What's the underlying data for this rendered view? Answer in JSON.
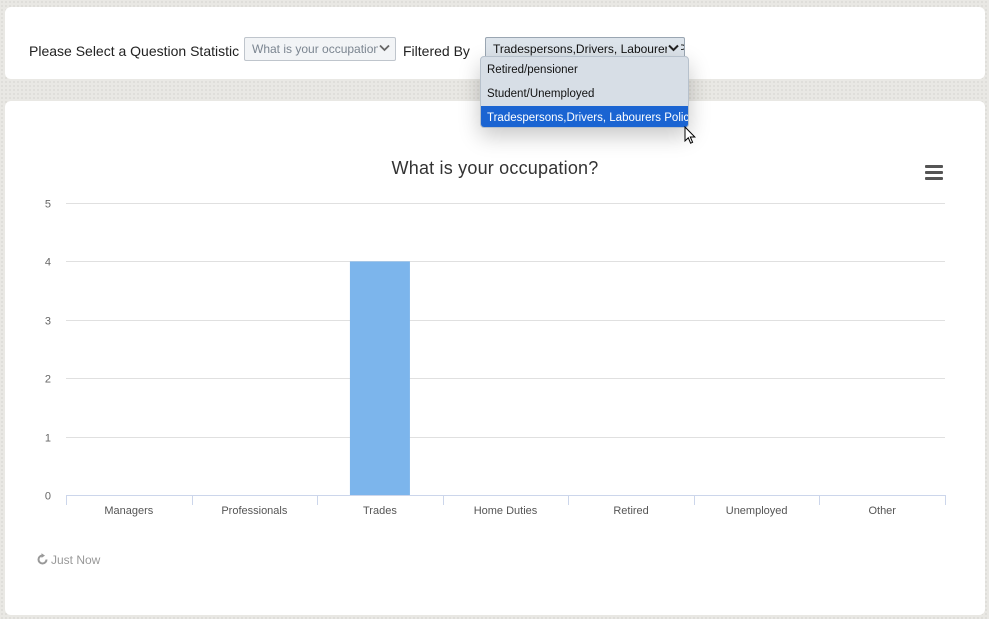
{
  "filter_bar": {
    "question_label": "Please Select a Question Statistic",
    "question_value": "What is your occupation?",
    "filter_label": "Filtered By",
    "filter_value": "Tradespersons,Drivers, Labourers Police",
    "options": [
      "Retired/pensioner",
      "Student/Unemployed",
      "Tradespersons,Drivers, Labourers Police"
    ],
    "selected_option": "Tradespersons,Drivers, Labourers Police"
  },
  "footer": {
    "updated_text": "Just Now"
  },
  "colors": {
    "bar": "#7cb5ec",
    "selected_option_bg": "#1a64d2",
    "grid": "#e0e0e0",
    "axis": "#ccd6eb"
  },
  "icons": {
    "menu": "hamburger-menu-icon",
    "refresh": "refresh-icon",
    "cursor": "mouse-pointer-icon",
    "dropdown": "chevron-down-icon"
  },
  "chart_data": {
    "type": "bar",
    "title": "What is your occupation?",
    "categories": [
      "Managers",
      "Professionals",
      "Trades",
      "Home Duties",
      "Retired",
      "Unemployed",
      "Other"
    ],
    "values": [
      0,
      0,
      4,
      0,
      0,
      0,
      0
    ],
    "ylim": [
      0,
      5
    ],
    "yticks": [
      0,
      1,
      2,
      3,
      4,
      5
    ],
    "grid": true,
    "legend": "none"
  }
}
